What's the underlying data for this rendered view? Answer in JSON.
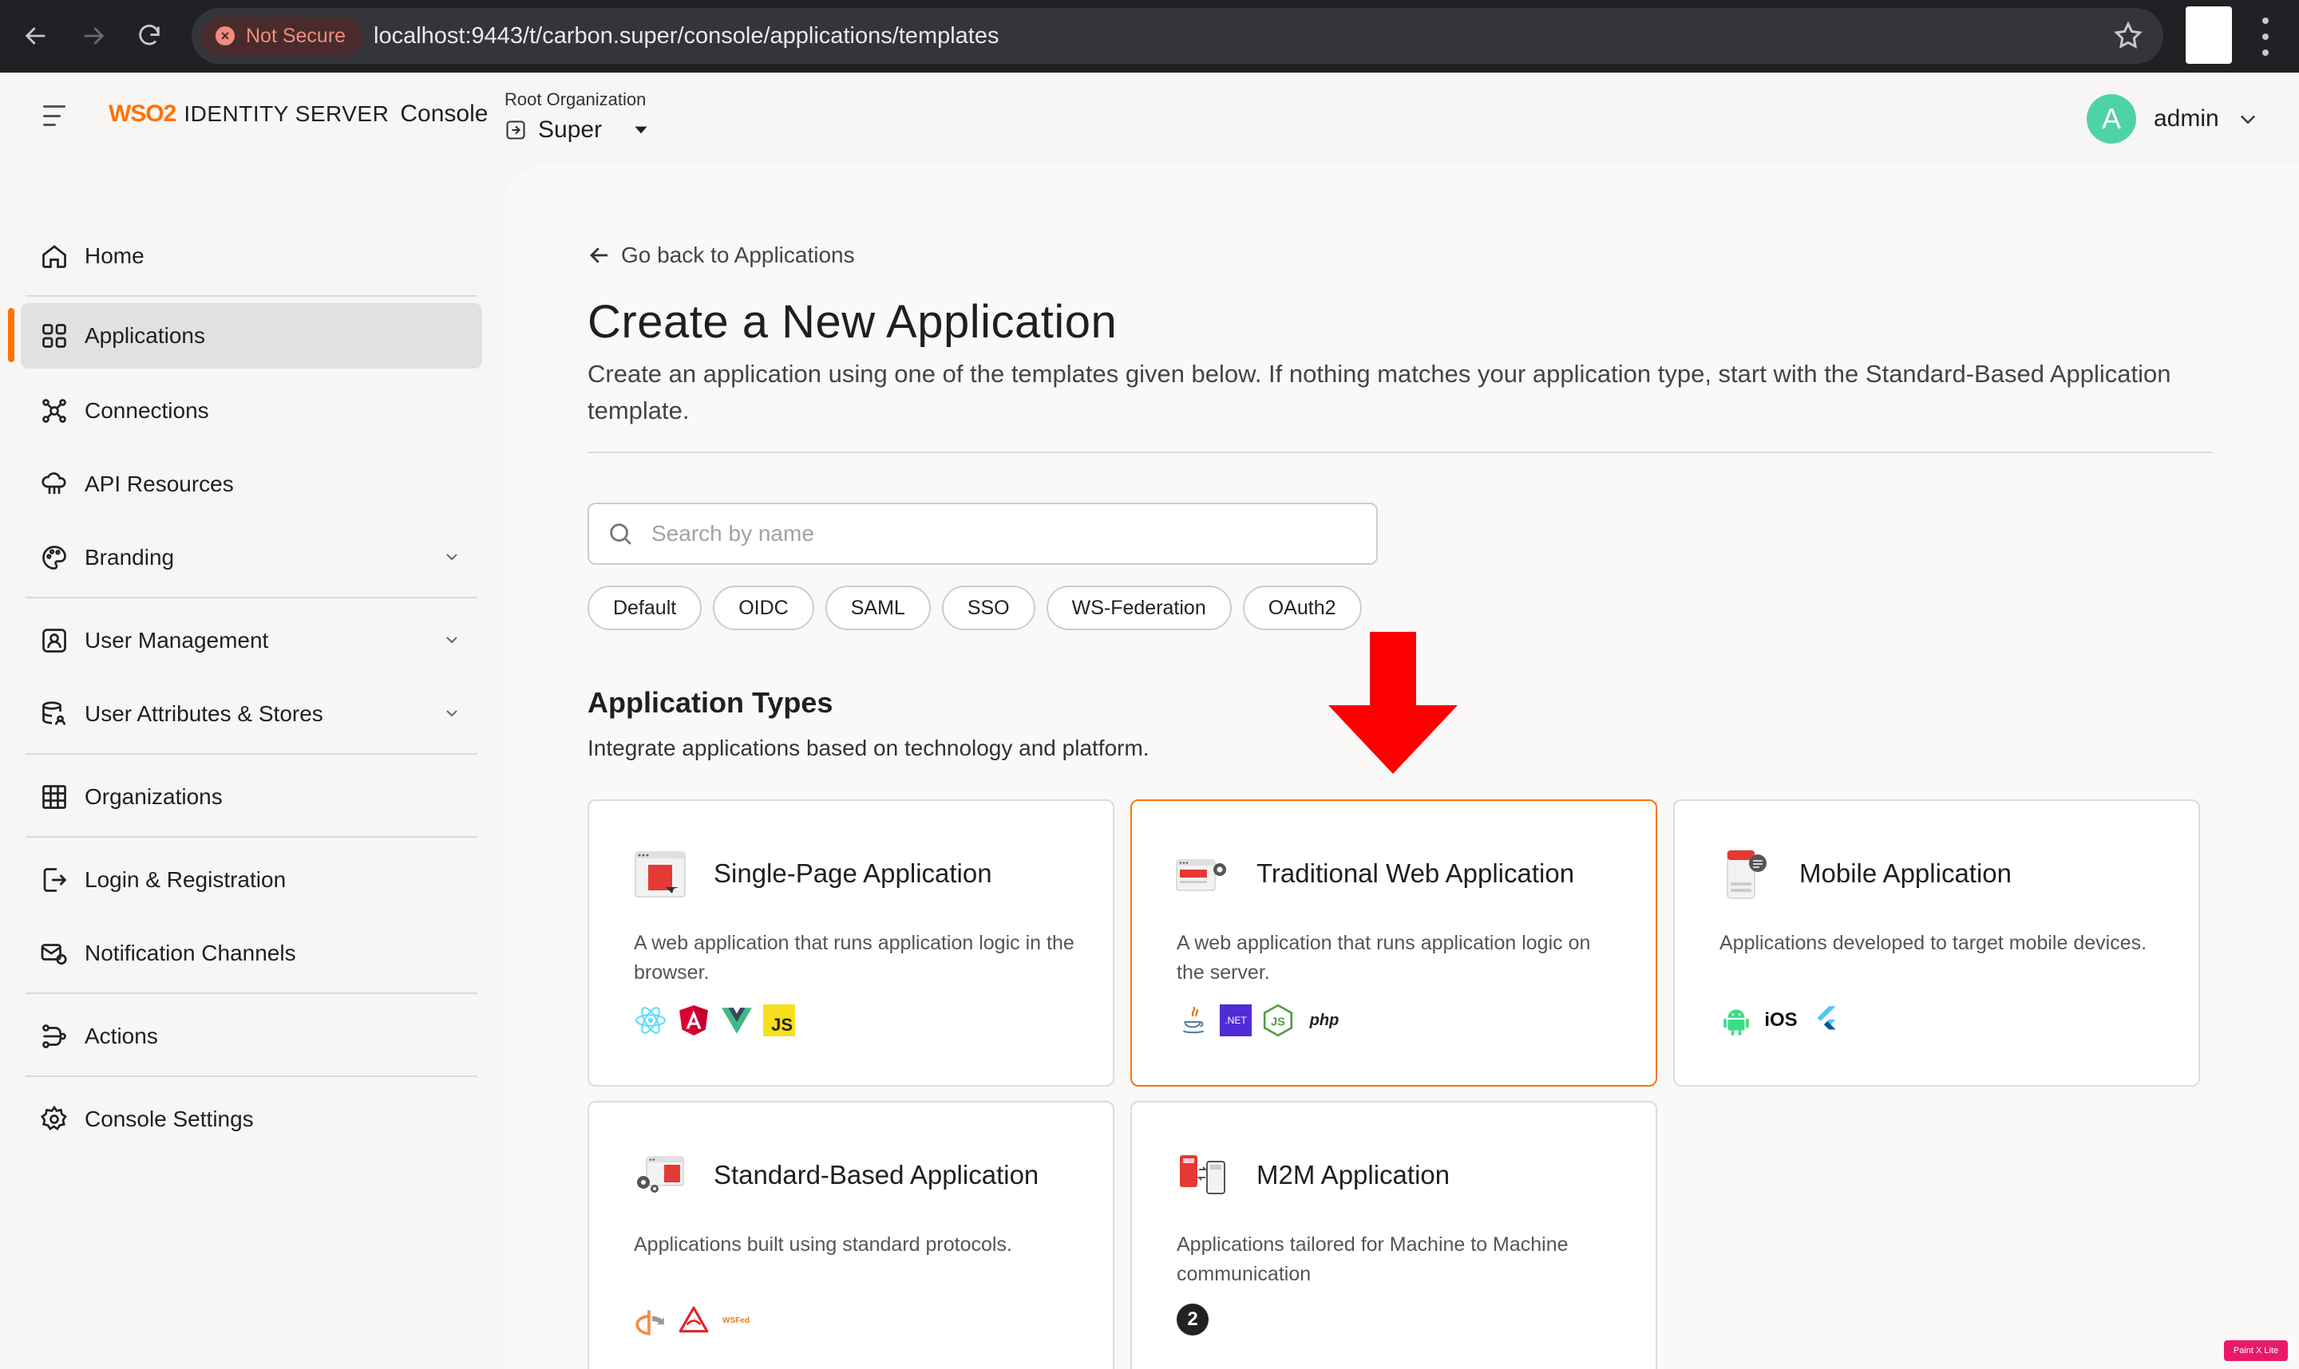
{
  "browser": {
    "security_label": "Not Secure",
    "url": "localhost:9443/t/carbon.super/console/applications/templates"
  },
  "header": {
    "logo_text": "WSO2",
    "product_name": "IDENTITY SERVER",
    "product_suffix": "Console",
    "org_label": "Root Organization",
    "org_name": "Super",
    "user_initial": "A",
    "user_name": "admin"
  },
  "sidebar": {
    "items": [
      {
        "label": "Home",
        "icon": "home-icon"
      },
      {
        "label": "Applications",
        "icon": "applications-icon",
        "active": true
      },
      {
        "label": "Connections",
        "icon": "connections-icon"
      },
      {
        "label": "API Resources",
        "icon": "api-resources-icon"
      },
      {
        "label": "Branding",
        "icon": "branding-icon",
        "expandable": true
      },
      {
        "label": "User Management",
        "icon": "user-management-icon",
        "expandable": true
      },
      {
        "label": "User Attributes & Stores",
        "icon": "user-attributes-icon",
        "expandable": true
      },
      {
        "label": "Organizations",
        "icon": "organizations-icon"
      },
      {
        "label": "Login & Registration",
        "icon": "login-registration-icon"
      },
      {
        "label": "Notification Channels",
        "icon": "notification-channels-icon"
      },
      {
        "label": "Actions",
        "icon": "actions-icon"
      },
      {
        "label": "Console Settings",
        "icon": "console-settings-icon"
      }
    ]
  },
  "main": {
    "back_link": "Go back to Applications",
    "title": "Create a New Application",
    "description": "Create an application using one of the templates given below. If nothing matches your application type, start with the Standard-Based Application template.",
    "search": {
      "placeholder": "Search by name"
    },
    "filters": [
      "Default",
      "OIDC",
      "SAML",
      "SSO",
      "WS-Federation",
      "OAuth2"
    ],
    "section_title": "Application Types",
    "section_subtitle": "Integrate applications based on technology and platform.",
    "cards": [
      {
        "title": "Single-Page Application",
        "description": "A web application that runs application logic in the browser.",
        "techs": [
          "react-icon",
          "angular-icon",
          "vue-icon",
          "javascript-icon"
        ],
        "tech_labels": {
          "js": "JS"
        }
      },
      {
        "title": "Traditional Web Application",
        "description": "A web application that runs application logic on the server.",
        "techs": [
          "java-icon",
          "dotnet-icon",
          "nodejs-icon",
          "php-icon"
        ],
        "tech_labels": {
          "dotnet": ".NET",
          "php": "php"
        },
        "highlighted": true
      },
      {
        "title": "Mobile Application",
        "description": "Applications developed to target mobile devices.",
        "techs": [
          "android-icon",
          "ios-icon",
          "flutter-icon"
        ],
        "tech_labels": {
          "ios": "iOS"
        }
      },
      {
        "title": "Standard-Based Application",
        "description": "Applications built using standard protocols.",
        "techs": [
          "openid-icon",
          "saml-icon",
          "wsfed-icon"
        ],
        "tech_labels": {
          "wsfed": "WSFed"
        }
      },
      {
        "title": "M2M Application",
        "description": "Applications tailored for Machine to Machine communication",
        "techs": [
          "oauth2-icon"
        ],
        "tech_labels": {
          "oauth2": "2"
        }
      }
    ]
  },
  "annotation": {
    "arrow_color": "#ff0000"
  },
  "watermark": "Paint X Lite",
  "colors": {
    "accent": "#ff7300",
    "avatar": "#4fd3a5",
    "active_bg": "#e3e1df"
  }
}
